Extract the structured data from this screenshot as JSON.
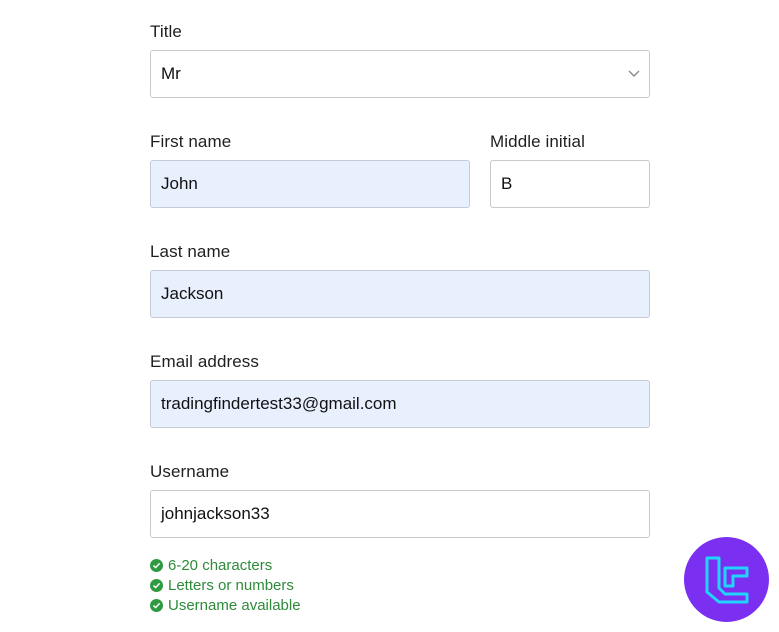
{
  "form": {
    "title": {
      "label": "Title",
      "value": "Mr",
      "icon": "chevron-down-icon"
    },
    "first_name": {
      "label": "First name",
      "value": "John"
    },
    "middle_initial": {
      "label": "Middle initial",
      "value": "B"
    },
    "last_name": {
      "label": "Last name",
      "value": "Jackson"
    },
    "email": {
      "label": "Email address",
      "value": "tradingfindertest33@gmail.com"
    },
    "username": {
      "label": "Username",
      "value": "johnjackson33",
      "rules": [
        "6-20 characters",
        "Letters or numbers",
        "Username available"
      ]
    }
  },
  "colors": {
    "autofill_bg": "#e8f0fe",
    "success": "#2e8b3a",
    "logo_bg": "#7b2ff0",
    "logo_fg": "#21d4fd"
  },
  "logo": {
    "icon": "brand-logo-icon"
  }
}
